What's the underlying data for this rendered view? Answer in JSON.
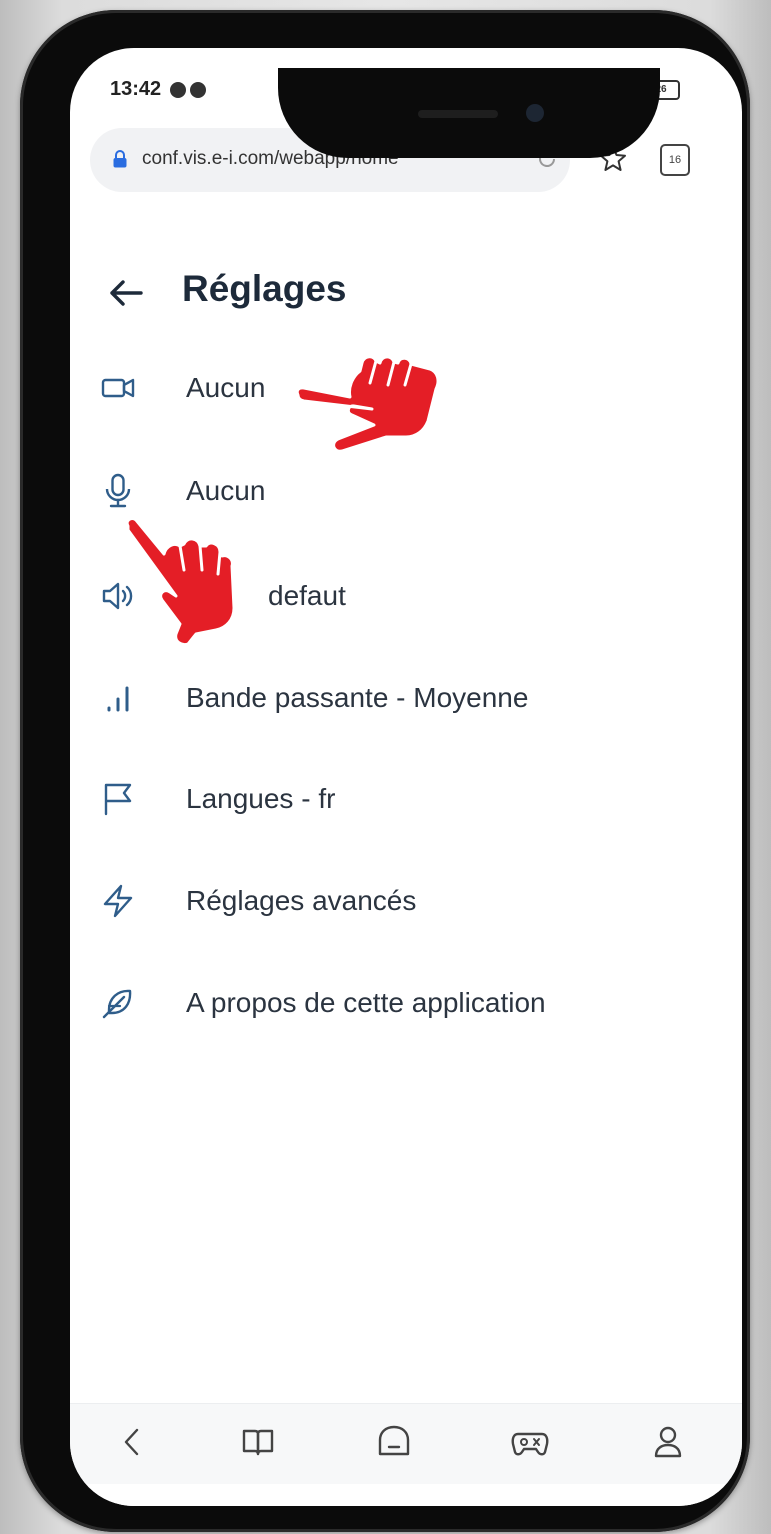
{
  "status_bar": {
    "time": "13:42",
    "battery": "26"
  },
  "browser": {
    "url": "conf.vis.e-i.com/webapp/home",
    "tab_count": "16"
  },
  "page": {
    "title": "Réglages"
  },
  "settings": [
    {
      "icon": "video-camera-icon",
      "label": "Aucun"
    },
    {
      "icon": "microphone-icon",
      "label": "Aucun"
    },
    {
      "icon": "speaker-icon",
      "label": "defaut"
    },
    {
      "icon": "bandwidth-icon",
      "label": "Bande passante - Moyenne"
    },
    {
      "icon": "flag-icon",
      "label": "Langues - fr"
    },
    {
      "icon": "lightning-icon",
      "label": "Réglages avancés"
    },
    {
      "icon": "feather-icon",
      "label": "A propos de cette application"
    }
  ],
  "colors": {
    "accent": "#2f5d8a",
    "hand": "#e41e26",
    "text": "#2b3440"
  }
}
